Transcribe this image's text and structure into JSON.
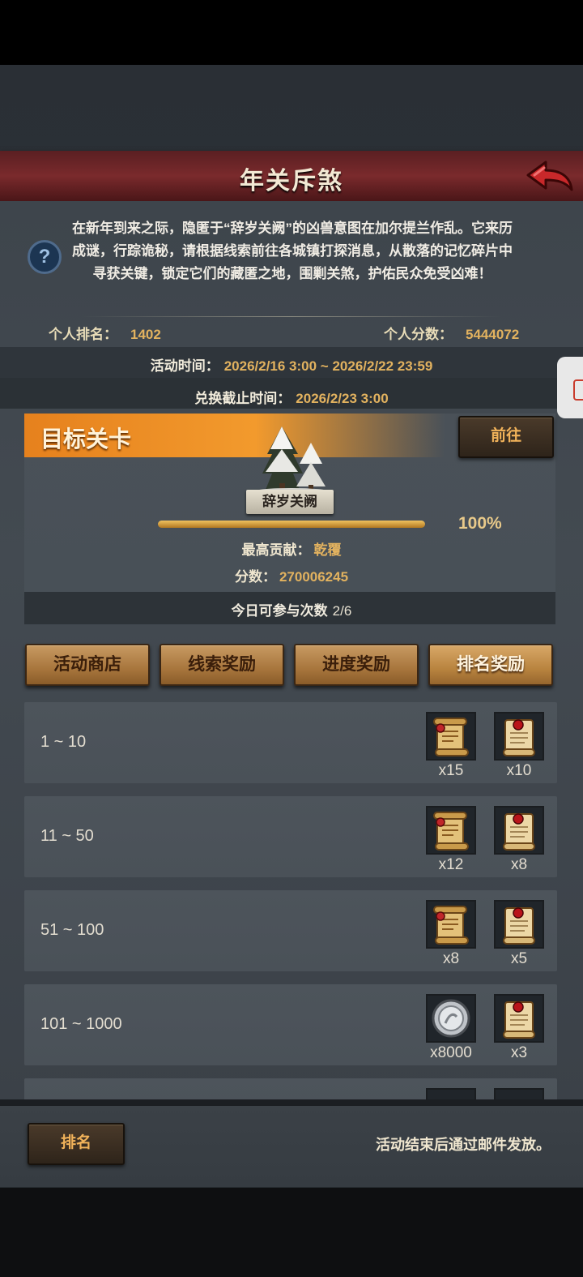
{
  "header": {
    "title": "年关斥煞",
    "back_icon": "back-arrow-icon"
  },
  "description": "在新年到来之际，隐匿于“辞岁关阙”的凶兽意图在加尔提兰作乱。它来历成谜，行踪诡秘，请根据线索前往各城镇打探消息，从散落的记忆碎片中寻获关键，锁定它们的藏匿之地，围剿关煞，护佑民众免受凶难！",
  "stats": {
    "rank_label": "个人排名：",
    "rank_value": "1402",
    "score_label": "个人分数：",
    "score_value": "5444072"
  },
  "times": {
    "activity_label": "活动时间：",
    "activity_value": "2026/2/16 3:00 ~ 2026/2/22 23:59",
    "exchange_label": "兑换截止时间：",
    "exchange_value": "2026/2/23 3:00"
  },
  "target": {
    "title": "目标关卡",
    "go_label": "前往",
    "stage_name": "辞岁关阙",
    "progress": 1.0,
    "progress_text": "100%",
    "top_contrib_label": "最高贡献：",
    "top_contrib_value": "乾覆",
    "score_label": "分数：",
    "score_value": "270006245",
    "attempts_label": "今日可参与次数",
    "attempts_value": "2/6"
  },
  "tabs": [
    {
      "label": "活动商店",
      "active": false
    },
    {
      "label": "线索奖励",
      "active": false
    },
    {
      "label": "进度奖励",
      "active": false
    },
    {
      "label": "排名奖励",
      "active": true
    }
  ],
  "rewards": [
    {
      "range": "1 ~ 10",
      "items": [
        {
          "icon": "gold-scroll-icon",
          "qty": "x15"
        },
        {
          "icon": "sealed-scroll-icon",
          "qty": "x10"
        }
      ]
    },
    {
      "range": "11 ~ 50",
      "items": [
        {
          "icon": "gold-scroll-icon",
          "qty": "x12"
        },
        {
          "icon": "sealed-scroll-icon",
          "qty": "x8"
        }
      ]
    },
    {
      "range": "51 ~ 100",
      "items": [
        {
          "icon": "gold-scroll-icon",
          "qty": "x8"
        },
        {
          "icon": "sealed-scroll-icon",
          "qty": "x5"
        }
      ]
    },
    {
      "range": "101 ~ 1000",
      "items": [
        {
          "icon": "silver-coin-icon",
          "qty": "x8000"
        },
        {
          "icon": "sealed-scroll-icon",
          "qty": "x3"
        }
      ]
    }
  ],
  "footer": {
    "rank_button": "排名",
    "note": "活动结束后通过邮件发放。"
  },
  "colors": {
    "accent_gold": "#e2b25f",
    "banner_red": "#7a2a2c",
    "target_orange": "#f29a2d"
  }
}
